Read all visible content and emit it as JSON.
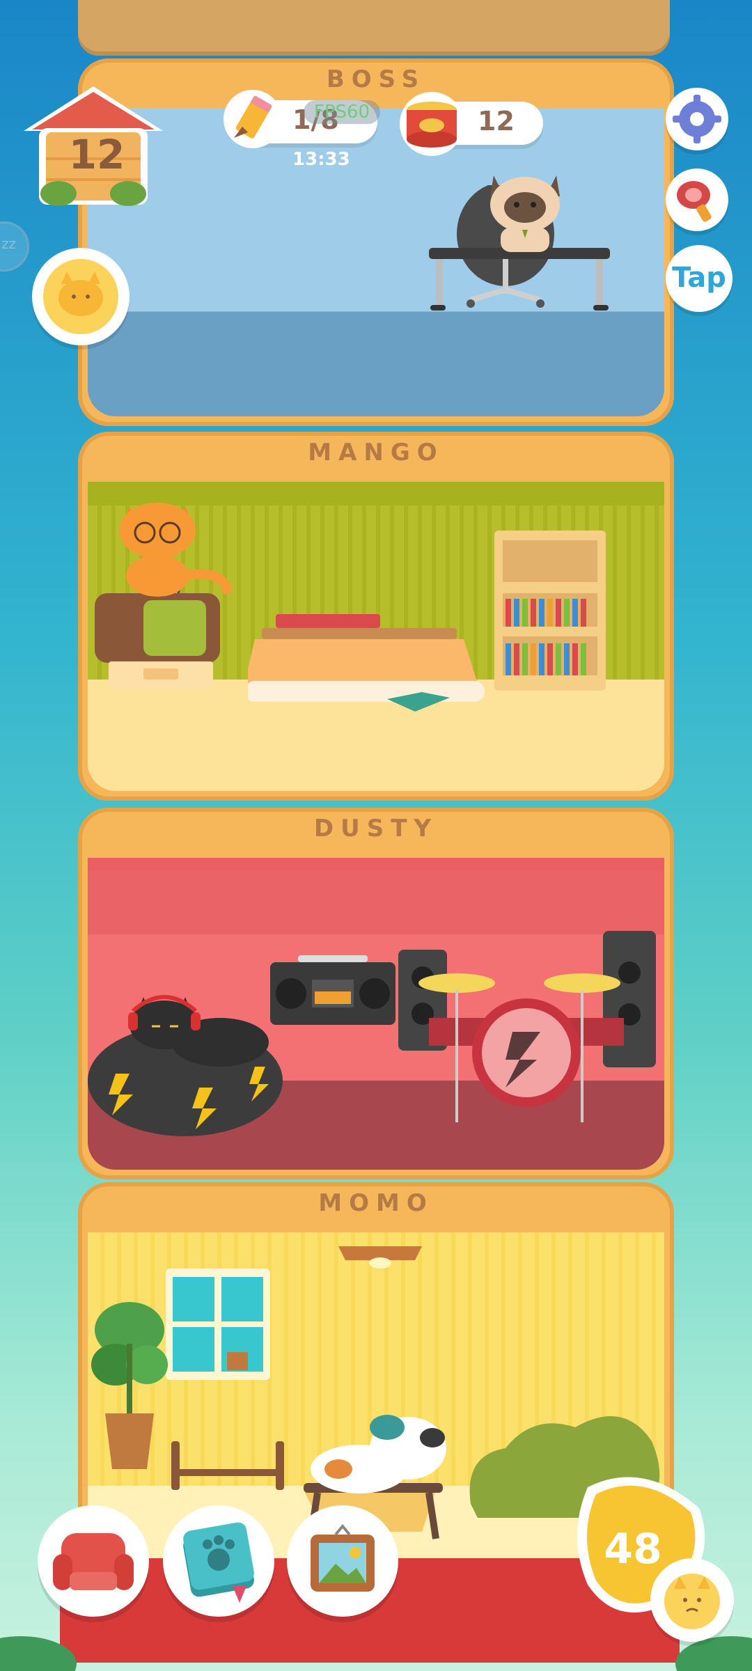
{
  "house": {
    "level": "12"
  },
  "hud": {
    "tasks_progress": "1/8",
    "timer": "13:33",
    "fps": "FPS60",
    "cans": "12"
  },
  "right_buttons": {
    "tap_label": "Tap"
  },
  "floors": [
    {
      "name": "BOSS"
    },
    {
      "name": "MANGO"
    },
    {
      "name": "DUSTY"
    },
    {
      "name": "MOMO"
    }
  ],
  "sleep_indicator": "zz",
  "bottom": {
    "fish_count": "48"
  },
  "colors": {
    "accent_orange": "#f5b75a",
    "roof_red": "#e25b4b",
    "bottom_bar_red": "#d83a3a",
    "tap_blue": "#2fa6d8",
    "coin_yellow": "#f7c531"
  }
}
